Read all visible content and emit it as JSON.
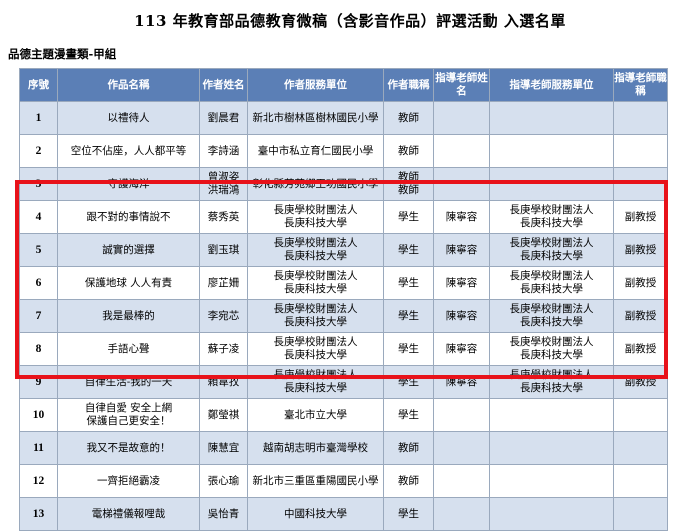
{
  "document": {
    "title": "113 年教育部品德教育微稿（含影音作品）評選活動 入選名單",
    "section": "品德主題漫畫類-甲組"
  },
  "table": {
    "headers": [
      "序號",
      "作品名稱",
      "作者姓名",
      "作者服務單位",
      "作者職稱",
      "指導老師姓名",
      "指導老師服務單位",
      "指導老師職稱"
    ],
    "rows": [
      {
        "no": "1",
        "work": "以禮待人",
        "author": "劉晨君",
        "unit": "新北市樹林區樹林國民小學",
        "title": "教師",
        "advisor": "",
        "advisor_unit": "",
        "advisor_title": ""
      },
      {
        "no": "2",
        "work": "空位不佔座，人人都平等",
        "author": "李詩涵",
        "unit": "臺中市私立育仁國民小學",
        "title": "教師",
        "advisor": "",
        "advisor_unit": "",
        "advisor_title": ""
      },
      {
        "no": "3",
        "work": "守護海洋",
        "author": "曾淑姿 洪瑞鴻",
        "unit": "彰化縣芳苑鄉王功國民小學",
        "title": "教師 教師",
        "advisor": "",
        "advisor_unit": "",
        "advisor_title": ""
      },
      {
        "no": "4",
        "work": "跟不對的事情說不",
        "author": "蔡秀英",
        "unit": "長庚學校財團法人 長庚科技大學",
        "title": "學生",
        "advisor": "陳寧容",
        "advisor_unit": "長庚學校財團法人 長庚科技大學",
        "advisor_title": "副教授"
      },
      {
        "no": "5",
        "work": "誠實的選擇",
        "author": "劉玉琪",
        "unit": "長庚學校財團法人 長庚科技大學",
        "title": "學生",
        "advisor": "陳寧容",
        "advisor_unit": "長庚學校財團法人 長庚科技大學",
        "advisor_title": "副教授"
      },
      {
        "no": "6",
        "work": "保護地球 人人有責",
        "author": "廖芷姍",
        "unit": "長庚學校財團法人 長庚科技大學",
        "title": "學生",
        "advisor": "陳寧容",
        "advisor_unit": "長庚學校財團法人 長庚科技大學",
        "advisor_title": "副教授"
      },
      {
        "no": "7",
        "work": "我是最棒的",
        "author": "李宛芯",
        "unit": "長庚學校財團法人 長庚科技大學",
        "title": "學生",
        "advisor": "陳寧容",
        "advisor_unit": "長庚學校財團法人 長庚科技大學",
        "advisor_title": "副教授"
      },
      {
        "no": "8",
        "work": "手語心聲",
        "author": "蘇子凌",
        "unit": "長庚學校財團法人 長庚科技大學",
        "title": "學生",
        "advisor": "陳寧容",
        "advisor_unit": "長庚學校財團法人 長庚科技大學",
        "advisor_title": "副教授"
      },
      {
        "no": "9",
        "work": "自律生活-我的一天",
        "author": "賴韋孜",
        "unit": "長庚學校財團法人 長庚科技大學",
        "title": "學生",
        "advisor": "陳寧容",
        "advisor_unit": "長庚學校財團法人 長庚科技大學",
        "advisor_title": "副教授"
      },
      {
        "no": "10",
        "work": "自律自愛 安全上網 保護自己更安全！",
        "author": "鄭瑩祺",
        "unit": "臺北市立大學",
        "title": "學生",
        "advisor": "",
        "advisor_unit": "",
        "advisor_title": ""
      },
      {
        "no": "11",
        "work": "我又不是故意的！",
        "author": "陳慧宜",
        "unit": "越南胡志明市臺灣學校",
        "title": "教師",
        "advisor": "",
        "advisor_unit": "",
        "advisor_title": ""
      },
      {
        "no": "12",
        "work": "一齊拒絕霸凌",
        "author": "張心瑜",
        "unit": "新北市三重區重陽國民小學",
        "title": "教師",
        "advisor": "",
        "advisor_unit": "",
        "advisor_title": ""
      },
      {
        "no": "13",
        "work": "電梯禮儀報哩哉",
        "author": "吳怡青",
        "unit": "中國科技大學",
        "title": "學生",
        "advisor": "",
        "advisor_unit": "",
        "advisor_title": ""
      }
    ]
  },
  "colors": {
    "header_bg": "#5b7fb6",
    "stripe_bg": "#d6e0ee",
    "highlight_border": "#e8121a"
  }
}
